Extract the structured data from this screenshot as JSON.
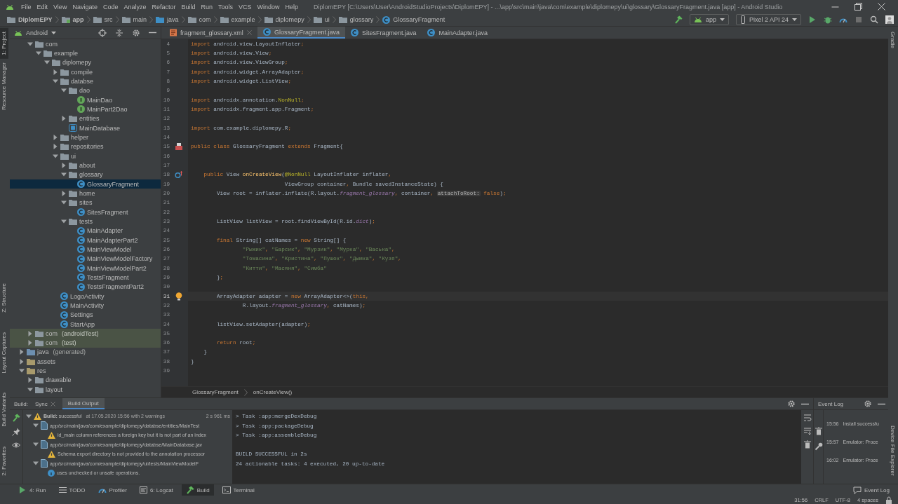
{
  "window": {
    "title": "DiplomEPY [C:\\Users\\User\\AndroidStudioProjects\\DiplomEPY] - ...\\app\\src\\main\\java\\com\\example\\diplomepy\\ui\\glossary\\GlossaryFragment.java [app] - Android Studio"
  },
  "menu": [
    "File",
    "Edit",
    "View",
    "Navigate",
    "Code",
    "Analyze",
    "Refactor",
    "Build",
    "Run",
    "Tools",
    "VCS",
    "Window",
    "Help"
  ],
  "breadcrumbs": [
    {
      "label": "DiplomEPY",
      "kind": "project"
    },
    {
      "label": "app",
      "kind": "module"
    },
    {
      "label": "src",
      "kind": "folder"
    },
    {
      "label": "main",
      "kind": "folder"
    },
    {
      "label": "java",
      "kind": "source-folder"
    },
    {
      "label": "com",
      "kind": "folder"
    },
    {
      "label": "example",
      "kind": "folder"
    },
    {
      "label": "diplomepy",
      "kind": "folder"
    },
    {
      "label": "ui",
      "kind": "folder"
    },
    {
      "label": "glossary",
      "kind": "folder"
    },
    {
      "label": "GlossaryFragment",
      "kind": "class"
    }
  ],
  "run_config": {
    "module": "app",
    "device": "Pixel 2 API 24"
  },
  "left_stripe": [
    {
      "label": "1: Project",
      "selected": true
    },
    {
      "label": "Resource Manager",
      "selected": false
    },
    {
      "label": "Z: Structure",
      "selected": false
    },
    {
      "label": "Layout Captures",
      "selected": false
    },
    {
      "label": "Build Variants",
      "selected": false
    },
    {
      "label": "2: Favorites",
      "selected": false
    }
  ],
  "right_stripe": [
    {
      "label": "Gradle",
      "selected": false
    },
    {
      "label": "Device File Explorer",
      "selected": false
    }
  ],
  "project": {
    "view": "Android",
    "tree": [
      {
        "children": [
          {
            "label": "com",
            "kind": "folder",
            "expanded": true,
            "selected": false,
            "children": [
              {
                "label": "example",
                "kind": "folder",
                "expanded": true,
                "selected": false,
                "children": [
                  {
                    "label": "diplomepy",
                    "kind": "folder",
                    "expanded": true,
                    "selected": false,
                    "children": [
                      {
                        "label": "compile",
                        "kind": "folder",
                        "expanded": false,
                        "selected": false
                      },
                      {
                        "label": "databse",
                        "kind": "folder",
                        "expanded": true,
                        "selected": false,
                        "children": [
                          {
                            "label": "dao",
                            "kind": "folder",
                            "expanded": true,
                            "selected": false,
                            "children": [
                              {
                                "label": "MainDao",
                                "kind": "interface",
                                "selected": false
                              },
                              {
                                "label": "MainPart2Dao",
                                "kind": "interface",
                                "selected": false
                              }
                            ]
                          },
                          {
                            "label": "entities",
                            "kind": "folder",
                            "expanded": false,
                            "selected": false
                          },
                          {
                            "label": "MainDatabase",
                            "kind": "database",
                            "selected": false
                          }
                        ]
                      },
                      {
                        "label": "helper",
                        "kind": "folder",
                        "expanded": false,
                        "selected": false
                      },
                      {
                        "label": "repositories",
                        "kind": "folder",
                        "expanded": false,
                        "selected": false
                      },
                      {
                        "label": "ui",
                        "kind": "folder",
                        "expanded": true,
                        "selected": false,
                        "children": [
                          {
                            "label": "about",
                            "kind": "folder",
                            "expanded": false,
                            "selected": false
                          },
                          {
                            "label": "glossary",
                            "kind": "folder",
                            "expanded": true,
                            "selected": false,
                            "children": [
                              {
                                "label": "GlossaryFragment",
                                "kind": "class",
                                "selected": true
                              }
                            ]
                          },
                          {
                            "label": "home",
                            "kind": "folder",
                            "expanded": false,
                            "selected": false
                          },
                          {
                            "label": "sites",
                            "kind": "folder",
                            "expanded": true,
                            "selected": false,
                            "children": [
                              {
                                "label": "SitesFragment",
                                "kind": "class",
                                "selected": false
                              }
                            ]
                          },
                          {
                            "label": "tests",
                            "kind": "folder",
                            "expanded": true,
                            "selected": false,
                            "children": [
                              {
                                "label": "MainAdapter",
                                "kind": "class",
                                "selected": false
                              },
                              {
                                "label": "MainAdapterPart2",
                                "kind": "class",
                                "selected": false
                              },
                              {
                                "label": "MainViewModel",
                                "kind": "class",
                                "selected": false
                              },
                              {
                                "label": "MainViewModelFactory",
                                "kind": "class",
                                "selected": false
                              },
                              {
                                "label": "MainViewModelPart2",
                                "kind": "class",
                                "selected": false
                              },
                              {
                                "label": "TestsFragment",
                                "kind": "class",
                                "selected": false
                              },
                              {
                                "label": "TestsFragmentPart2",
                                "kind": "class",
                                "selected": false
                              }
                            ]
                          }
                        ]
                      },
                      {
                        "label": "LogoActivity",
                        "kind": "class",
                        "selected": false
                      },
                      {
                        "label": "MainActivity",
                        "kind": "class",
                        "selected": false
                      },
                      {
                        "label": "Settings",
                        "kind": "class",
                        "selected": false
                      },
                      {
                        "label": "StartApp",
                        "kind": "class",
                        "selected": false
                      }
                    ]
                  }
                ]
              }
            ]
          },
          {
            "label": "com",
            "suffix": "(androidTest)",
            "kind": "test-folder",
            "expanded": false,
            "selected": false
          },
          {
            "label": "com",
            "suffix": "(test)",
            "kind": "test-folder",
            "expanded": false,
            "selected": false
          }
        ]
      },
      {
        "label": "java",
        "suffix": "(generated)",
        "kind": "generated-folder",
        "expanded": false,
        "selected": false
      },
      {
        "label": "assets",
        "kind": "resource-folder",
        "expanded": false,
        "selected": false
      },
      {
        "label": "res",
        "kind": "resource-folder",
        "expanded": true,
        "selected": false,
        "children": [
          {
            "label": "drawable",
            "kind": "folder",
            "expanded": false,
            "selected": false
          },
          {
            "label": "layout",
            "kind": "folder",
            "expanded": true,
            "selected": false
          }
        ]
      }
    ]
  },
  "editor": {
    "tabs": [
      {
        "label": "fragment_glossary.xml",
        "kind": "xml",
        "selected": false,
        "closable": true
      },
      {
        "label": "GlossaryFragment.java",
        "kind": "class",
        "selected": true,
        "closable": false
      },
      {
        "label": "SitesFragment.java",
        "kind": "class",
        "selected": false,
        "closable": false
      },
      {
        "label": "MainAdapter.java",
        "kind": "class",
        "selected": false,
        "closable": false
      }
    ],
    "lines": [
      {
        "number": "4",
        "current": false,
        "tokens": [
          {
            "kind": "keyword",
            "text": "import"
          },
          " android.view.LayoutInflater",
          {
            "kind": "keyword",
            "text": ";"
          }
        ]
      },
      {
        "number": "5",
        "current": false,
        "tokens": [
          {
            "kind": "keyword",
            "text": "import"
          },
          " android.view.View",
          {
            "kind": "keyword",
            "text": ";"
          }
        ]
      },
      {
        "number": "6",
        "current": false,
        "tokens": [
          {
            "kind": "keyword",
            "text": "import"
          },
          " android.view.ViewGroup",
          {
            "kind": "keyword",
            "text": ";"
          }
        ]
      },
      {
        "number": "7",
        "current": false,
        "tokens": [
          {
            "kind": "keyword",
            "text": "import"
          },
          " android.widget.ArrayAdapter",
          {
            "kind": "keyword",
            "text": ";"
          }
        ]
      },
      {
        "number": "8",
        "current": false,
        "tokens": [
          {
            "kind": "keyword",
            "text": "import"
          },
          " android.widget.ListView",
          {
            "kind": "keyword",
            "text": ";"
          }
        ]
      },
      {
        "number": "9",
        "current": false
      },
      {
        "number": "10",
        "current": false,
        "tokens": [
          {
            "kind": "keyword",
            "text": "import"
          },
          " androidx.annotation.",
          {
            "kind": "annotation",
            "text": "NonNull"
          },
          {
            "kind": "keyword",
            "text": ";"
          }
        ]
      },
      {
        "number": "11",
        "current": false,
        "tokens": [
          {
            "kind": "keyword",
            "text": "import"
          },
          " androidx.fragment.app.Fragment",
          {
            "kind": "keyword",
            "text": ";"
          }
        ]
      },
      {
        "number": "12",
        "current": false
      },
      {
        "number": "13",
        "current": false,
        "tokens": [
          {
            "kind": "keyword",
            "text": "import"
          },
          " com.example.diplomepy.R",
          {
            "kind": "keyword",
            "text": ";"
          }
        ]
      },
      {
        "number": "14",
        "current": false
      },
      {
        "number": "15",
        "current": false,
        "gutter": {
          "kind": "marker"
        },
        "tokens": [
          {
            "kind": "keyword",
            "text": "public class"
          },
          " GlossaryFragment ",
          {
            "kind": "keyword",
            "text": "extends"
          },
          " Fragment{"
        ]
      },
      {
        "number": "16",
        "current": false
      },
      {
        "number": "17",
        "current": false
      },
      {
        "number": "18",
        "current": false,
        "gutter": {
          "kind": "override"
        },
        "tokens": [
          {
            "kind": "keyword",
            "text": "    public"
          },
          " View ",
          {
            "kind": "declaration",
            "text": "onCreateView"
          },
          "(",
          {
            "kind": "annotation",
            "text": "@NonNull"
          },
          " LayoutInflater inflater",
          {
            "kind": "keyword",
            "text": ","
          }
        ]
      },
      {
        "number": "19",
        "current": false,
        "tokens": [
          "                             ViewGroup container",
          {
            "kind": "keyword",
            "text": ","
          },
          " Bundle savedInstanceState) {"
        ]
      },
      {
        "number": "20",
        "current": false,
        "tokens": [
          "        View root = inflater.inflate(R.layout.",
          {
            "kind": "field",
            "text": "fragment_glossary"
          },
          {
            "kind": "keyword",
            "text": ","
          },
          " container",
          {
            "kind": "keyword",
            "text": ", "
          },
          {
            "kind": "hint",
            "text": "attachToRoot:"
          },
          {
            "kind": "keyword",
            "text": " false"
          },
          ")",
          {
            "kind": "keyword",
            "text": ";"
          }
        ]
      },
      {
        "number": "21",
        "current": false
      },
      {
        "number": "22",
        "current": false
      },
      {
        "number": "23",
        "current": false,
        "tokens": [
          "        ListView listView = root.findViewById(R.id.",
          {
            "kind": "field",
            "text": "dict"
          },
          ")",
          {
            "kind": "keyword",
            "text": ";"
          }
        ]
      },
      {
        "number": "24",
        "current": false
      },
      {
        "number": "25",
        "current": false,
        "tokens": [
          {
            "kind": "keyword",
            "text": "        final"
          },
          " String[] catNames = ",
          {
            "kind": "keyword",
            "text": "new"
          },
          " String[] {"
        ]
      },
      {
        "number": "26",
        "current": false,
        "tokens": [
          {
            "kind": "string",
            "text": "                \"Рыжик\""
          },
          {
            "kind": "keyword",
            "text": ", "
          },
          {
            "kind": "string",
            "text": "\"Барсик\""
          },
          {
            "kind": "keyword",
            "text": ", "
          },
          {
            "kind": "string",
            "text": "\"Мурзик\""
          },
          {
            "kind": "keyword",
            "text": ", "
          },
          {
            "kind": "string",
            "text": "\"Мурка\""
          },
          {
            "kind": "keyword",
            "text": ", "
          },
          {
            "kind": "string",
            "text": "\"Васька\""
          },
          {
            "kind": "keyword",
            "text": ","
          }
        ]
      },
      {
        "number": "27",
        "current": false,
        "tokens": [
          {
            "kind": "string",
            "text": "                \"Томасина\""
          },
          {
            "kind": "keyword",
            "text": ", "
          },
          {
            "kind": "string",
            "text": "\"Кристина\""
          },
          {
            "kind": "keyword",
            "text": ", "
          },
          {
            "kind": "string",
            "text": "\"Пушок\""
          },
          {
            "kind": "keyword",
            "text": ", "
          },
          {
            "kind": "string",
            "text": "\"Дымка\""
          },
          {
            "kind": "keyword",
            "text": ", "
          },
          {
            "kind": "string",
            "text": "\"Кузя\""
          },
          {
            "kind": "keyword",
            "text": ","
          }
        ]
      },
      {
        "number": "28",
        "current": false,
        "tokens": [
          {
            "kind": "string",
            "text": "                \"Китти\""
          },
          {
            "kind": "keyword",
            "text": ", "
          },
          {
            "kind": "string",
            "text": "\"Масяня\""
          },
          {
            "kind": "keyword",
            "text": ", "
          },
          {
            "kind": "string",
            "text": "\"Симба\""
          }
        ]
      },
      {
        "number": "29",
        "current": false,
        "tokens": [
          "        }",
          {
            "kind": "keyword",
            "text": ";"
          }
        ]
      },
      {
        "number": "30",
        "current": false
      },
      {
        "number": "31",
        "current": true,
        "gutter": {
          "kind": "intention"
        },
        "tokens": [
          "        ArrayAdapter adapter = ",
          {
            "kind": "keyword",
            "text": "new"
          },
          " ArrayAdapter<>(",
          {
            "kind": "keyword",
            "text": "this,"
          }
        ]
      },
      {
        "number": "32",
        "current": false,
        "tokens": [
          "                R.layout.",
          {
            "kind": "field",
            "text": "fragment_glossary"
          },
          {
            "kind": "keyword",
            "text": ","
          },
          " catNames)",
          {
            "kind": "keyword",
            "text": ";"
          }
        ]
      },
      {
        "number": "33",
        "current": false
      },
      {
        "number": "34",
        "current": false,
        "tokens": [
          "        listView.setAdapter(adapter)",
          {
            "kind": "keyword",
            "text": ";"
          }
        ]
      },
      {
        "number": "35",
        "current": false
      },
      {
        "number": "36",
        "current": false,
        "tokens": [
          {
            "kind": "keyword",
            "text": "        return"
          },
          " root",
          {
            "kind": "keyword",
            "text": ";"
          }
        ]
      },
      {
        "number": "37",
        "current": false,
        "tokens": [
          "    }"
        ]
      },
      {
        "number": "38",
        "current": false,
        "tokens": [
          "}"
        ]
      },
      {
        "number": "39",
        "current": false
      }
    ],
    "path": [
      "GlossaryFragment",
      "onCreateView()"
    ]
  },
  "build": {
    "label": "Build:",
    "tabs": [
      {
        "label": "Sync",
        "selected": false,
        "closable": true
      },
      {
        "label": "Build Output",
        "selected": true,
        "closable": false
      }
    ],
    "messages": [
      {
        "kind": "warning",
        "text": "**Build:** successful",
        "detail": "at 17.05.2020 15:56 with 2 warnings",
        "duration": "2 s 961 ms",
        "expanded": true,
        "children": [
          {
            "kind": "file",
            "text": "app/src/main/java/com/example/diplomepy/databse/entities/MainTest",
            "expanded": true,
            "children": [
              {
                "kind": "warning",
                "text": "id_main column references a foreign key but it is not part of an index"
              }
            ]
          },
          {
            "kind": "file",
            "text": "app/src/main/java/com/example/diplomepy/databse/MainDatabase.jav",
            "expanded": true,
            "children": [
              {
                "kind": "warning",
                "text": "Schema export directory is not provided to the annotation processor"
              }
            ]
          },
          {
            "kind": "file",
            "text": "app/src/main/java/com/example/diplomepy/ui/tests/MainViewModelF",
            "expanded": true,
            "children": [
              {
                "kind": "info",
                "text": "uses unchecked or unsafe operations."
              }
            ]
          }
        ]
      }
    ],
    "console": [
      "> Task :app:mergeDexDebug",
      "> Task :app:packageDebug",
      "> Task :app:assembleDebug",
      "BUILD SUCCESSFUL in 2s",
      "24 actionable tasks: 4 executed, 20 up-to-date"
    ]
  },
  "event_log": {
    "title": "Event Log",
    "entries": [
      {
        "time": "15:56",
        "text": "Install successfu"
      },
      {
        "time": "15:57",
        "text": "Emulator: Proce"
      },
      {
        "time": "16:02",
        "text": "Emulator: Proce"
      }
    ]
  },
  "tool_windows": [
    {
      "label": "4: Run",
      "kind": "run",
      "selected": false
    },
    {
      "label": "TODO",
      "kind": "todo",
      "selected": false
    },
    {
      "label": "Profiler",
      "kind": "profiler",
      "selected": false
    },
    {
      "label": "6: Logcat",
      "kind": "logcat",
      "selected": false
    },
    {
      "label": "Build",
      "kind": "build",
      "selected": true
    },
    {
      "label": "Terminal",
      "kind": "terminal",
      "selected": false
    }
  ],
  "event_log_button": "Event Log",
  "status_bar": [
    "31:56",
    "CRLF",
    "UTF-8",
    "4 spaces"
  ]
}
